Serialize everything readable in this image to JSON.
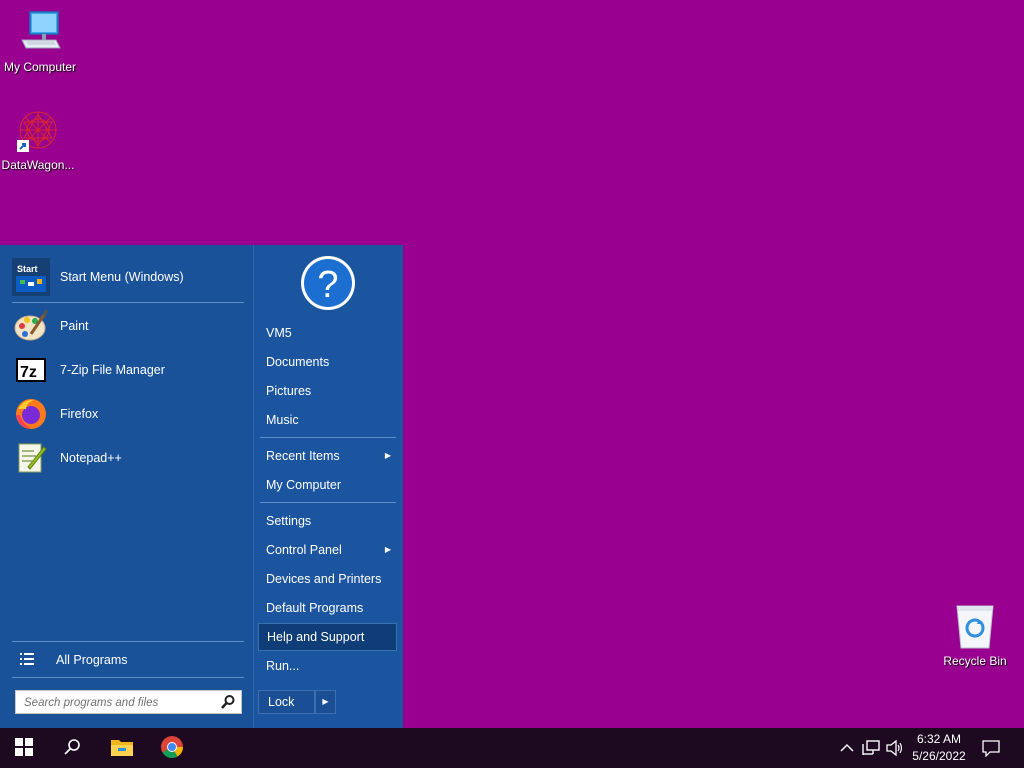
{
  "desktop": {
    "icons": [
      {
        "label": "My Computer"
      },
      {
        "label": "DataWagon..."
      },
      {
        "label": "Recycle Bin"
      }
    ]
  },
  "start_menu": {
    "header_item": {
      "label": "Start Menu (Windows)",
      "icon": "start-menu-icon"
    },
    "programs": [
      {
        "label": "Paint",
        "icon": "paint-icon"
      },
      {
        "label": "7-Zip File Manager",
        "icon": "7zip-icon"
      },
      {
        "label": "Firefox",
        "icon": "firefox-icon"
      },
      {
        "label": "Notepad++",
        "icon": "notepadpp-icon"
      }
    ],
    "all_programs": "All Programs",
    "search_placeholder": "Search programs and files",
    "right_items": [
      {
        "label": "VM5"
      },
      {
        "label": "Documents"
      },
      {
        "label": "Pictures"
      },
      {
        "label": "Music"
      },
      {
        "label": "Recent Items",
        "submenu": true
      },
      {
        "label": "My Computer"
      },
      {
        "label": "Settings"
      },
      {
        "label": "Control Panel",
        "submenu": true
      },
      {
        "label": "Devices and Printers"
      },
      {
        "label": "Default Programs"
      },
      {
        "label": "Help and Support",
        "highlighted": true
      },
      {
        "label": "Run..."
      }
    ],
    "lock_label": "Lock",
    "seven_zip_glyph": "7z",
    "help_glyph": "?"
  },
  "taskbar": {
    "clock_time": "6:32 AM",
    "clock_date": "5/26/2022",
    "pinned": [
      "file-explorer-icon",
      "chrome-icon"
    ]
  },
  "colors": {
    "desktop": "#9a0090",
    "menu": "#1a4f96",
    "taskbar": "#1d0a20",
    "highlight": "#0f3d78"
  }
}
